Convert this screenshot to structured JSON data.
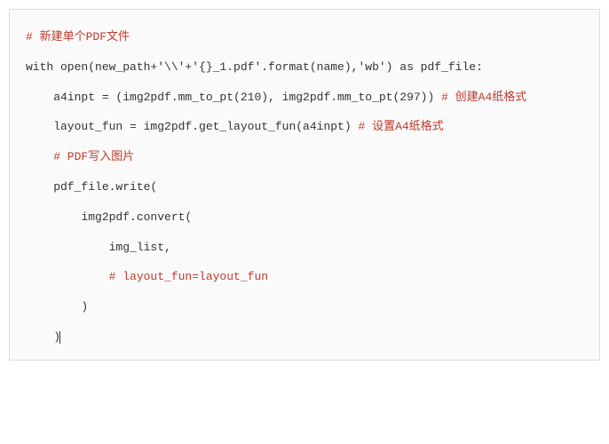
{
  "code": {
    "l1_comment": "# 新建单个PDF文件",
    "l2_code": "with open(new_path+'\\\\'+'{}_1.pdf'.format(name),'wb') as pdf_file:",
    "l3_code": "    a4inpt = (img2pdf.mm_to_pt(210), img2pdf.mm_to_pt(297)) ",
    "l3_comment": "# 创建A4纸格式",
    "l4_code": "    layout_fun = img2pdf.get_layout_fun(a4inpt) ",
    "l4_comment": "# 设置A4纸格式",
    "l5_comment": "    # PDF写入图片",
    "l6_code": "    pdf_file.write(",
    "l7_code": "        img2pdf.convert(",
    "l8_code": "            img_list,",
    "l9_comment": "            # layout_fun=layout_fun",
    "l10_code": "        )",
    "l11_code": "    )"
  },
  "chart_data": {
    "type": "code",
    "language": "python",
    "lines": [
      {
        "text": "# 新建单个PDF文件",
        "is_comment": true
      },
      {
        "text": "",
        "is_blank": true
      },
      {
        "text": "with open(new_path+'\\\\'+'{}_1.pdf'.format(name),'wb') as pdf_file:"
      },
      {
        "text": "",
        "is_blank": true
      },
      {
        "text": "    a4inpt = (img2pdf.mm_to_pt(210), img2pdf.mm_to_pt(297)) # 创建A4纸格式",
        "trailing_comment": "# 创建A4纸格式"
      },
      {
        "text": "",
        "is_blank": true
      },
      {
        "text": "    layout_fun = img2pdf.get_layout_fun(a4inpt) # 设置A4纸格式",
        "trailing_comment": "# 设置A4纸格式"
      },
      {
        "text": "",
        "is_blank": true
      },
      {
        "text": "    # PDF写入图片",
        "is_comment": true
      },
      {
        "text": "",
        "is_blank": true
      },
      {
        "text": "    pdf_file.write("
      },
      {
        "text": "",
        "is_blank": true
      },
      {
        "text": "        img2pdf.convert("
      },
      {
        "text": "",
        "is_blank": true
      },
      {
        "text": "            img_list,"
      },
      {
        "text": "",
        "is_blank": true
      },
      {
        "text": "            # layout_fun=layout_fun",
        "is_comment": true
      },
      {
        "text": "",
        "is_blank": true
      },
      {
        "text": "        )"
      },
      {
        "text": "",
        "is_blank": true
      },
      {
        "text": "    )"
      }
    ]
  }
}
